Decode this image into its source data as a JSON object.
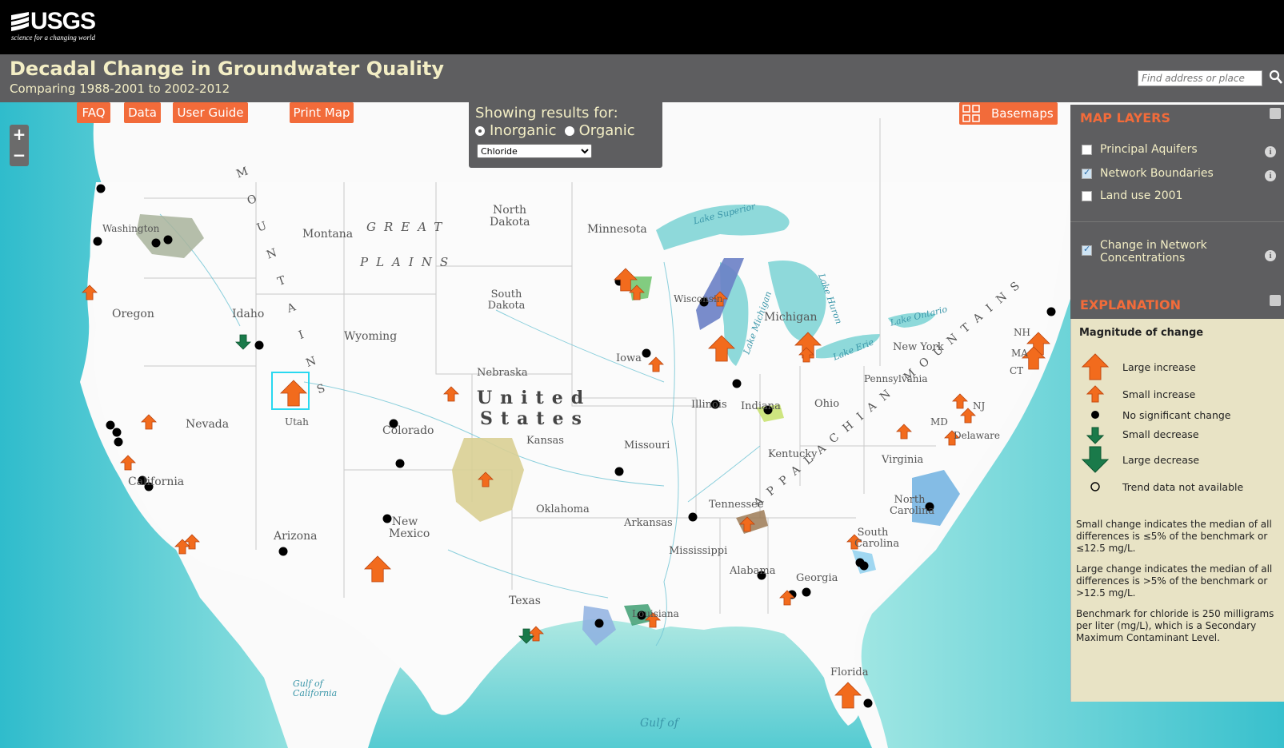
{
  "header": {
    "logo_text": "USGS",
    "logo_tagline": "science for a changing world",
    "title": "Decadal Change in Groundwater Quality",
    "subtitle": "Comparing 1988-2001 to 2002-2012",
    "search_placeholder": "Find address or place"
  },
  "toolbar": {
    "faq": "FAQ",
    "data": "Data",
    "user_guide": "User Guide",
    "print_map": "Print Map",
    "basemaps": "Basemaps"
  },
  "zoom": {
    "in": "+",
    "out": "−"
  },
  "showing": {
    "heading": "Showing results for:",
    "option_inorganic": "Inorganic",
    "option_organic": "Organic",
    "selected_option": "Inorganic",
    "constituent": "Chloride"
  },
  "map_layers": {
    "title": "MAP LAYERS",
    "items": [
      {
        "label": "Principal Aquifers",
        "checked": false
      },
      {
        "label": "Network Boundaries",
        "checked": true
      },
      {
        "label": "Land use 2001",
        "checked": false
      },
      {
        "label": "Change in Network Concentrations",
        "checked": true
      }
    ]
  },
  "explanation": {
    "title": "EXPLANATION",
    "heading": "Magnitude of change",
    "legend": [
      {
        "label": "Large increase",
        "symbol": "arrow-up-large",
        "color": "#f26b1d"
      },
      {
        "label": "Small increase",
        "symbol": "arrow-up-small",
        "color": "#f26b1d"
      },
      {
        "label": "No significant change",
        "symbol": "dot",
        "color": "#000000"
      },
      {
        "label": "Small decrease",
        "symbol": "arrow-down-small",
        "color": "#1a7a4a"
      },
      {
        "label": "Large decrease",
        "symbol": "arrow-down-large",
        "color": "#1a7a4a"
      },
      {
        "label": "Trend data not available",
        "symbol": "circle-open",
        "color": "#000000"
      }
    ],
    "note_small": "Small change indicates the median of all differences is ≤5% of the benchmark or ≤12.5 mg/L.",
    "note_large": "Large change indicates the median of all differences is >5% of the benchmark or >12.5 mg/L.",
    "note_benchmark": "Benchmark for chloride is 250 milligrams per liter (mg/L), which is a Secondary Maximum Contaminant Level."
  },
  "map_labels": {
    "country": [
      "United",
      "States"
    ],
    "regions": [
      "GREAT",
      "PLAINS"
    ],
    "rocky": "MOUNTAINS",
    "appalachian": "APPALACHIAN MOUNTAINS",
    "states": [
      "Washington",
      "Oregon",
      "Idaho",
      "Montana",
      "Wyoming",
      "Nevada",
      "California",
      "Utah",
      "Arizona",
      "Colorado",
      "New Mexico",
      "North Dakota",
      "South Dakota",
      "Nebraska",
      "Kansas",
      "Oklahoma",
      "Texas",
      "Minnesota",
      "Iowa",
      "Missouri",
      "Arkansas",
      "Louisiana",
      "Wisconsin",
      "Illinois",
      "Michigan",
      "Indiana",
      "Ohio",
      "Kentucky",
      "Tennessee",
      "Mississippi",
      "Alabama",
      "Georgia",
      "Florida",
      "South Carolina",
      "North Carolina",
      "Virginia",
      "Pennsylvania",
      "New York",
      "NH",
      "MA",
      "CT",
      "NJ",
      "MD",
      "Delaware"
    ],
    "water": [
      "Gulf of California",
      "Gulf of",
      "Lake Superior",
      "Lake Michigan",
      "Lake Huron",
      "Lake Erie",
      "Lake Ontario"
    ]
  },
  "colors": {
    "accent": "#f26b3a",
    "panel": "#5e5e60",
    "title_text": "#f3eec5",
    "ocean": "#5fcbd0",
    "land": "#fafafa",
    "increase": "#f26b1d",
    "decrease": "#1a7a4a"
  }
}
